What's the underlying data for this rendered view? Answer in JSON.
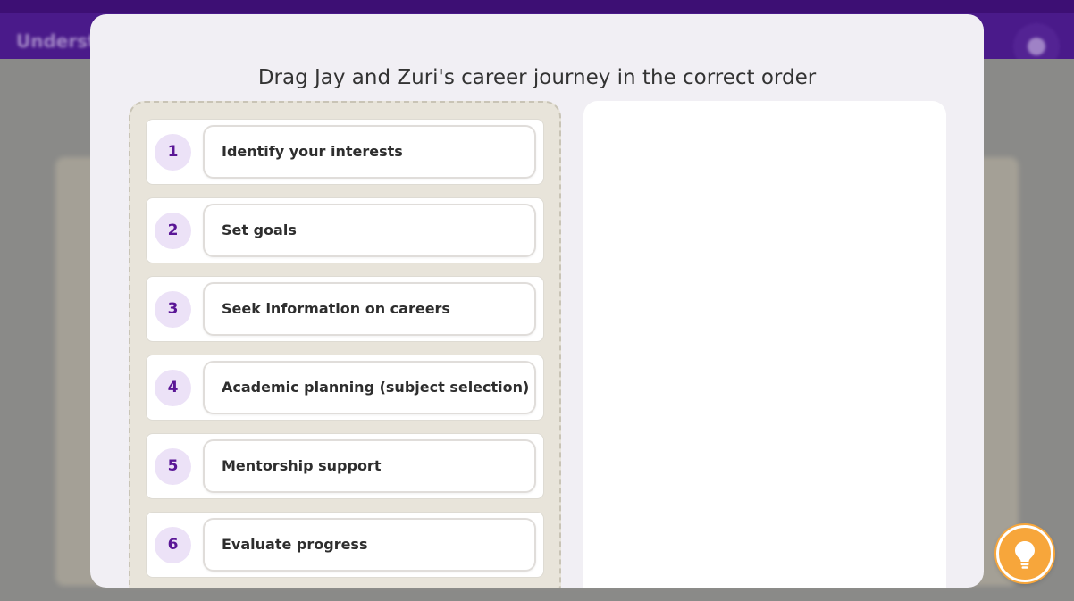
{
  "app": {
    "header_title": "Underst"
  },
  "modal": {
    "title": "Drag Jay and Zuri's career journey in the correct order",
    "items": [
      {
        "number": "1",
        "label": "Identify your interests"
      },
      {
        "number": "2",
        "label": "Set goals"
      },
      {
        "number": "3",
        "label": "Seek information on careers"
      },
      {
        "number": "4",
        "label": "Academic planning (subject selection)"
      },
      {
        "number": "5",
        "label": "Mentorship support"
      },
      {
        "number": "6",
        "label": "Evaluate progress"
      }
    ]
  },
  "hint": {
    "icon": "lightbulb-icon",
    "color": "#f7a63b"
  },
  "colors": {
    "brand_purple": "#4a1a8a",
    "number_text": "#5a1696",
    "number_bg": "#ece2f7"
  }
}
